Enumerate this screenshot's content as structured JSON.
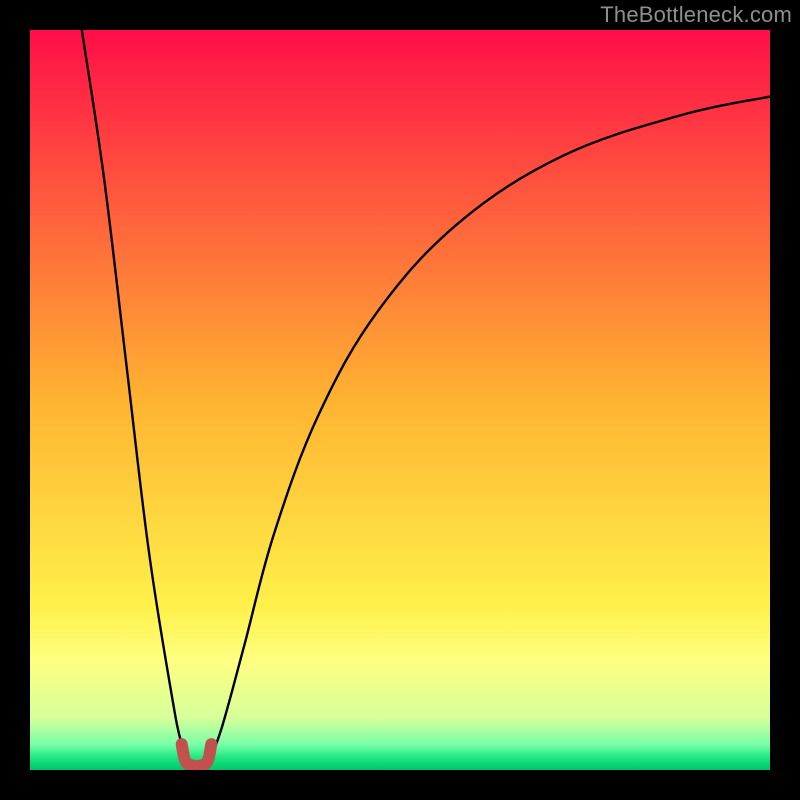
{
  "watermark": "TheBottleneck.com",
  "colors": {
    "frame": "#000000",
    "curve": "#000000",
    "marker": "#c1514e",
    "gradient_stops": [
      {
        "offset": 0.0,
        "color": "#ff0e48"
      },
      {
        "offset": 0.5,
        "color": "#ffb331"
      },
      {
        "offset": 0.78,
        "color": "#fff14a"
      },
      {
        "offset": 0.85,
        "color": "#ffff80"
      },
      {
        "offset": 0.93,
        "color": "#d6ff9a"
      },
      {
        "offset": 0.965,
        "color": "#7affa8"
      },
      {
        "offset": 0.985,
        "color": "#18e47f"
      },
      {
        "offset": 1.0,
        "color": "#00c56a"
      }
    ]
  },
  "chart_data": {
    "type": "line",
    "title": "",
    "xlabel": "",
    "ylabel": "",
    "xlim": [
      0,
      100
    ],
    "ylim": [
      0,
      100
    ],
    "note": "Bottleneck-style V-curve. Two curves descend to ~0 and diverge; minimum region highlighted.",
    "series": [
      {
        "name": "left-descent",
        "type": "line",
        "x": [
          7,
          10,
          13,
          16,
          19,
          20.5,
          22
        ],
        "y": [
          100,
          80,
          55,
          30,
          11,
          3.5,
          0.5
        ]
      },
      {
        "name": "right-ascent",
        "type": "line",
        "x": [
          24,
          26,
          29,
          33,
          39,
          47,
          58,
          72,
          88,
          100
        ],
        "y": [
          0.5,
          6,
          17,
          32,
          48,
          62,
          74,
          83,
          88.5,
          91
        ]
      },
      {
        "name": "minimum-marker",
        "type": "line",
        "x": [
          20.5,
          21,
          22,
          23,
          24,
          24.5
        ],
        "y": [
          3.5,
          1.2,
          0.6,
          0.6,
          1.2,
          3.5
        ]
      }
    ]
  }
}
